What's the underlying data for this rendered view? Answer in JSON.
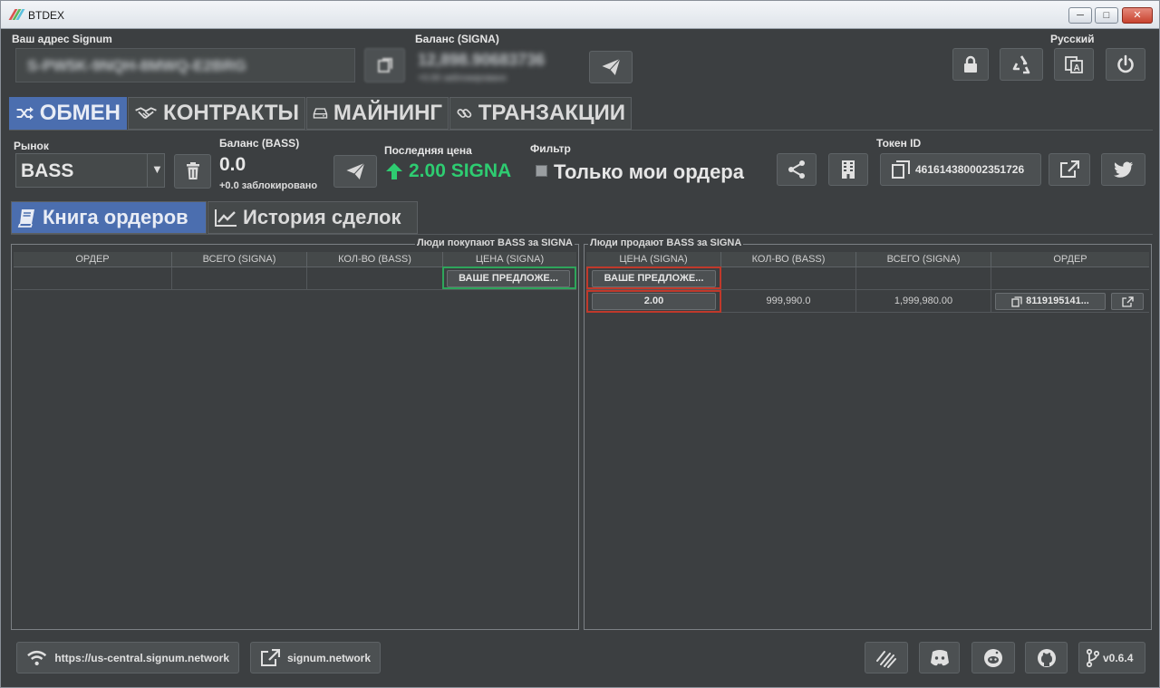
{
  "window": {
    "title": "BTDEX",
    "minimize": "─",
    "maximize": "□",
    "close": "✕"
  },
  "header": {
    "address_label": "Ваш адрес Signum",
    "address_value": "S-PW5K-9NQH-8MWQ-E2BRG",
    "balance_label": "Баланс (SIGNA)",
    "balance_value": "12,898.90683736",
    "balance_sub": "+0.00 заблокировано",
    "language": "Русский"
  },
  "tabs": [
    {
      "label": "ОБМЕН",
      "icon": "shuffle-icon"
    },
    {
      "label": "КОНТРАКТЫ",
      "icon": "handshake-icon"
    },
    {
      "label": "МАЙНИНГ",
      "icon": "hdd-icon"
    },
    {
      "label": "ТРАНЗАКЦИИ",
      "icon": "link-icon"
    }
  ],
  "market": {
    "market_label": "Рынок",
    "market_value": "BASS",
    "balance_label": "Баланс (BASS)",
    "balance_value": "0.0",
    "balance_locked": "+0.0 заблокировано",
    "last_price_label": "Последняя цена",
    "last_price_value": "2.00 SIGNA",
    "filter_label": "Фильтр",
    "filter_checkbox": "Только мои ордера",
    "token_label": "Токен ID",
    "token_value": "461614380002351726"
  },
  "subtabs": [
    {
      "label": "Книга ордеров",
      "icon": "book-icon"
    },
    {
      "label": "История сделок",
      "icon": "line-chart-icon"
    }
  ],
  "buy_panel": {
    "title": "Люди покупают BASS за SIGNA",
    "columns": [
      "ОРДЕР",
      "ВСЕГО (SIGNA)",
      "КОЛ-ВО (BASS)",
      "ЦЕНА (SIGNA)"
    ],
    "offer_button": "ВАШЕ ПРЕДЛОЖЕ..."
  },
  "sell_panel": {
    "title": "Люди продают BASS за SIGNA",
    "columns": [
      "ЦЕНА (SIGNA)",
      "КОЛ-ВО (BASS)",
      "ВСЕГО (SIGNA)",
      "ОРДЕР"
    ],
    "offer_button": "ВАШЕ ПРЕДЛОЖЕ...",
    "rows": [
      {
        "price": "2.00",
        "amount": "999,990.0",
        "total": "1,999,980.00",
        "order": "8119195141..."
      }
    ]
  },
  "footer": {
    "node": "https://us-central.signum.network",
    "site": "signum.network",
    "version": "v0.6.4"
  },
  "colors": {
    "background": "#3c3f41",
    "accent_tab": "#4b6eaf",
    "price_up": "#2ecc71",
    "highlight_buy": "#2ea55b",
    "highlight_sell": "#c0392b"
  }
}
